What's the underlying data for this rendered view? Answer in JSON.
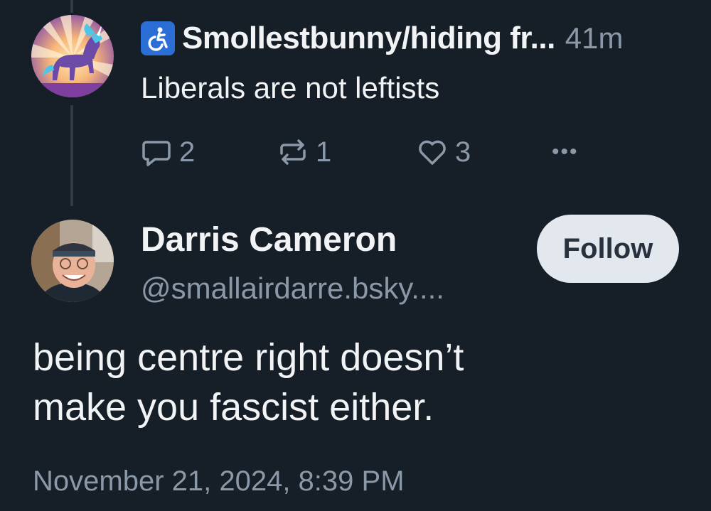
{
  "parent_post": {
    "author_name": "Smollestbunny/hiding fr...",
    "badge_icon": "accessibility-icon",
    "badge_color": "#2b6fd6",
    "timestamp": "41m",
    "text": "Liberals are not leftists",
    "reply_count": "2",
    "repost_count": "1",
    "like_count": "3",
    "more_label": "•••"
  },
  "main_post": {
    "author_name": "Darris Cameron",
    "handle": "@smallairdarre.bsky....",
    "follow_label": "Follow",
    "text_lines": [
      "being centre right doesn’t",
      "make you fascist either."
    ],
    "date": "November 21, 2024, 8:39 PM"
  },
  "colors": {
    "background": "#161e27",
    "primary_text": "#f1f3f5",
    "secondary_text": "#8b98a8",
    "follow_button_bg": "#e3e8ee",
    "thread_line": "#2e3a48"
  }
}
